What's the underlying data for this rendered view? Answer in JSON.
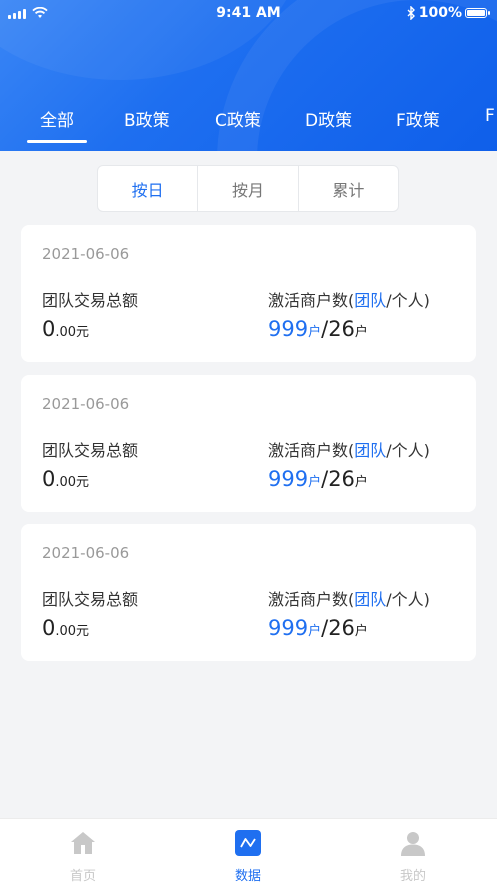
{
  "status": {
    "time": "9:41 AM",
    "battery": "100%"
  },
  "tabs": [
    {
      "label": "全部"
    },
    {
      "label": "B政策"
    },
    {
      "label": "C政策"
    },
    {
      "label": "D政策"
    },
    {
      "label": "F政策"
    },
    {
      "label": "F"
    }
  ],
  "segments": {
    "day": "按日",
    "month": "按月",
    "total": "累计"
  },
  "cards": [
    {
      "date": "2021-06-06",
      "trade_label": "团队交易总额",
      "merchant_label_pre": "激活商户数(",
      "merchant_label_team": "团队",
      "merchant_label_post": "/个人)",
      "amount_int": "0",
      "amount_dec": ".00元",
      "team_count": "999",
      "team_unit": "户",
      "sep": "/",
      "personal_count": "26",
      "personal_unit": "户"
    },
    {
      "date": "2021-06-06",
      "trade_label": "团队交易总额",
      "merchant_label_pre": "激活商户数(",
      "merchant_label_team": "团队",
      "merchant_label_post": "/个人)",
      "amount_int": "0",
      "amount_dec": ".00元",
      "team_count": "999",
      "team_unit": "户",
      "sep": "/",
      "personal_count": "26",
      "personal_unit": "户"
    },
    {
      "date": "2021-06-06",
      "trade_label": "团队交易总额",
      "merchant_label_pre": "激活商户数(",
      "merchant_label_team": "团队",
      "merchant_label_post": "/个人)",
      "amount_int": "0",
      "amount_dec": ".00元",
      "team_count": "999",
      "team_unit": "户",
      "sep": "/",
      "personal_count": "26",
      "personal_unit": "户"
    }
  ],
  "bottom_nav": [
    {
      "label": "首页",
      "icon": "home-icon"
    },
    {
      "label": "数据",
      "icon": "chart-icon"
    },
    {
      "label": "我的",
      "icon": "user-icon"
    }
  ],
  "colors": {
    "accent": "#1f6ff0",
    "inactive": "#c8c8c8"
  }
}
